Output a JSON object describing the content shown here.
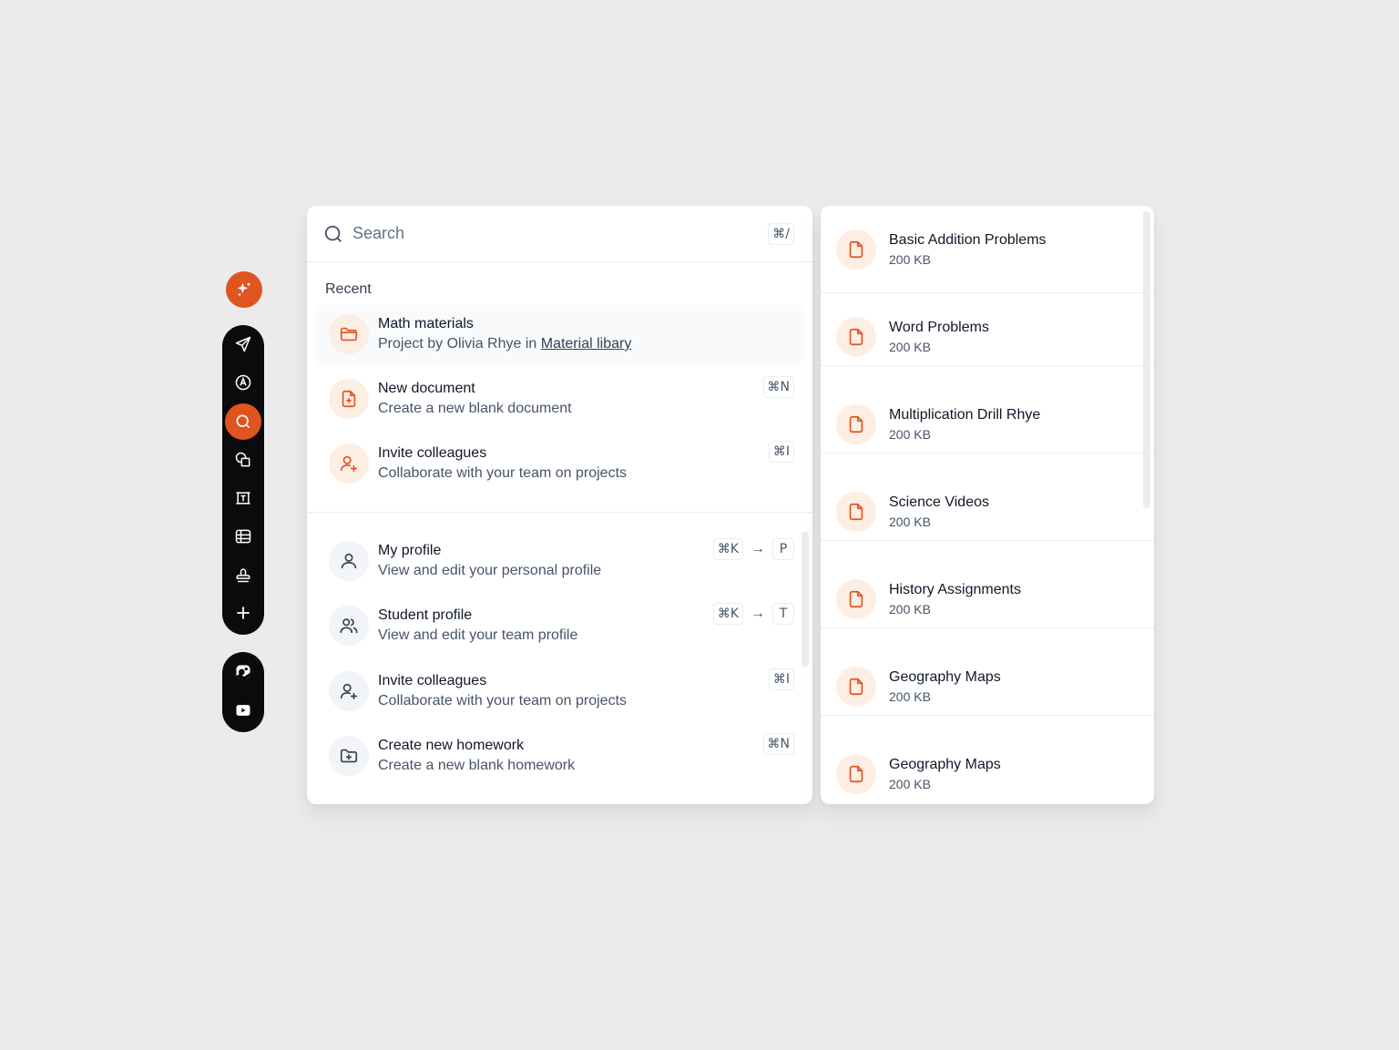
{
  "toolbar": {
    "magic": "sparkle-icon",
    "tools": [
      {
        "icon": "send-icon",
        "active": false
      },
      {
        "icon": "pen-tool-icon",
        "active": false
      },
      {
        "icon": "search-icon",
        "active": true
      },
      {
        "icon": "shapes-icon",
        "active": false
      },
      {
        "icon": "text-frame-icon",
        "active": false
      },
      {
        "icon": "table-icon",
        "active": false
      },
      {
        "icon": "stamp-icon",
        "active": false
      },
      {
        "icon": "plus-icon",
        "active": false
      }
    ],
    "apps": [
      {
        "icon": "image-app-icon"
      },
      {
        "icon": "youtube-icon"
      }
    ]
  },
  "search": {
    "placeholder": "Search",
    "shortcut": "⌘/"
  },
  "recent": {
    "label": "Recent",
    "items": [
      {
        "title": "Math materials",
        "subtitle_prefix": "Project by Olivia Rhye in ",
        "subtitle_link": "Material libary",
        "icon": "folder-icon"
      },
      {
        "title": "New document",
        "subtitle": "Create a new blank document",
        "shortcut": "⌘N",
        "icon": "file-plus-icon"
      },
      {
        "title": "Invite colleagues",
        "subtitle": "Collaborate with your team on projects",
        "shortcut": "⌘I",
        "icon": "user-plus-icon"
      }
    ]
  },
  "actions": {
    "items": [
      {
        "title": "My profile",
        "subtitle": "View and edit your personal profile",
        "shortcut": "⌘K",
        "key": "P",
        "icon": "user-icon"
      },
      {
        "title": "Student profile",
        "subtitle": "View and edit your team profile",
        "shortcut": "⌘K",
        "key": "T",
        "icon": "users-icon"
      },
      {
        "title": "Invite colleagues",
        "subtitle": "Collaborate with your team on projects",
        "shortcut": "⌘I",
        "icon": "user-plus-icon"
      },
      {
        "title": "Create new homework",
        "subtitle": "Create a new blank homework",
        "shortcut": "⌘N",
        "icon": "folder-plus-icon"
      }
    ]
  },
  "files": [
    {
      "name": "Basic Addition Problems",
      "size": "200 KB"
    },
    {
      "name": "Word Problems",
      "size": "200 KB"
    },
    {
      "name": "Multiplication Drill Rhye",
      "size": "200 KB"
    },
    {
      "name": "Science Videos",
      "size": "200 KB"
    },
    {
      "name": "History Assignments",
      "size": "200 KB"
    },
    {
      "name": "Geography Maps",
      "size": "200 KB"
    },
    {
      "name": "Geography Maps",
      "size": "200 KB"
    }
  ],
  "colors": {
    "accent": "#e0541f",
    "accent_soft": "#fdeee4",
    "toolbar": "#0b0b0b",
    "background": "#ebebeb"
  }
}
